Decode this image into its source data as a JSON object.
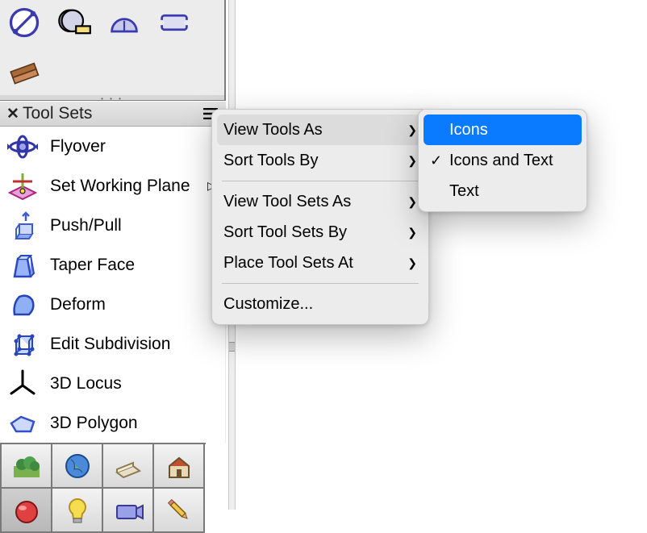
{
  "panel": {
    "title": "Tool Sets"
  },
  "topbar_icons": [
    {
      "name": "circle-diag-icon"
    },
    {
      "name": "tape-measure-icon"
    },
    {
      "name": "protractor-icon"
    },
    {
      "name": "ticket-icon"
    },
    {
      "name": "lumber-icon"
    }
  ],
  "tools": [
    {
      "name": "flyover",
      "label": "Flyover",
      "icon": "flyover-icon",
      "has_sub": false
    },
    {
      "name": "set-working-plane",
      "label": "Set Working Plane",
      "icon": "plane-icon",
      "has_sub": true
    },
    {
      "name": "push-pull",
      "label": "Push/Pull",
      "icon": "pushpull-icon",
      "has_sub": false
    },
    {
      "name": "taper-face",
      "label": "Taper Face",
      "icon": "taper-icon",
      "has_sub": false
    },
    {
      "name": "deform",
      "label": "Deform",
      "icon": "deform-icon",
      "has_sub": false
    },
    {
      "name": "edit-subdivision",
      "label": "Edit Subdivision",
      "icon": "subdiv-icon",
      "has_sub": false
    },
    {
      "name": "3d-locus",
      "label": "3D Locus",
      "icon": "locus-icon",
      "has_sub": false
    },
    {
      "name": "3d-polygon",
      "label": "3D Polygon",
      "icon": "polygon-icon",
      "has_sub": false
    }
  ],
  "bottom_grid": [
    {
      "name": "landscape-icon",
      "active": false
    },
    {
      "name": "globe-icon",
      "active": false
    },
    {
      "name": "sheet-icon",
      "active": false
    },
    {
      "name": "house-icon",
      "active": false
    },
    {
      "name": "ball-icon",
      "active": true
    },
    {
      "name": "bulb-icon",
      "active": false
    },
    {
      "name": "camera-icon",
      "active": false
    },
    {
      "name": "pencil-icon",
      "active": false
    }
  ],
  "context_menu": {
    "groups": [
      [
        {
          "name": "view-tools-as",
          "label": "View Tools As",
          "submenu": true,
          "hover": true
        },
        {
          "name": "sort-tools-by",
          "label": "Sort Tools By",
          "submenu": true,
          "hover": false
        }
      ],
      [
        {
          "name": "view-tool-sets-as",
          "label": "View Tool Sets As",
          "submenu": true,
          "hover": false
        },
        {
          "name": "sort-tool-sets-by",
          "label": "Sort Tool Sets By",
          "submenu": true,
          "hover": false
        },
        {
          "name": "place-tool-sets-at",
          "label": "Place Tool Sets At",
          "submenu": true,
          "hover": false
        }
      ],
      [
        {
          "name": "customize",
          "label": "Customize...",
          "submenu": false,
          "hover": false
        }
      ]
    ]
  },
  "submenu": {
    "items": [
      {
        "name": "icons",
        "label": "Icons",
        "checked": false,
        "highlighted": true
      },
      {
        "name": "icons-and-text",
        "label": "Icons and Text",
        "checked": true,
        "highlighted": false
      },
      {
        "name": "text",
        "label": "Text",
        "checked": false,
        "highlighted": false
      }
    ]
  }
}
